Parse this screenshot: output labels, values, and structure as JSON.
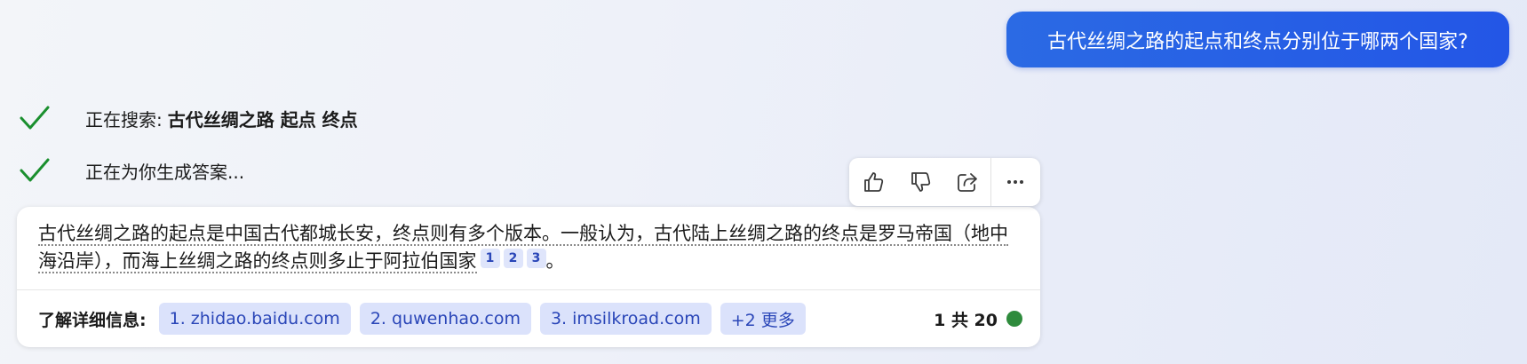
{
  "user_message": "古代丝绸之路的起点和终点分别位于哪两个国家?",
  "status": {
    "searching_label": "正在搜索:",
    "searching_query": "古代丝绸之路 起点 终点",
    "generating_label": "正在为你生成答案..."
  },
  "answer": {
    "text_underlined": "古代丝绸之路的起点是中国古代都城长安，终点则有多个版本。一般认为，古代陆上丝绸之路的终点是罗马帝国（地中海沿岸），而海上丝绸之路的终点则多止于阿拉伯国家",
    "citations": [
      "1",
      "2",
      "3"
    ],
    "text_end": "。"
  },
  "references": {
    "label": "了解详细信息:",
    "items": [
      "1. zhidao.baidu.com",
      "2. quwenhao.com",
      "3. imsilkroad.com"
    ],
    "more": "+2 更多"
  },
  "page_count": "1 共 20",
  "actions": [
    {
      "name": "thumbs-up",
      "icon": "thumbs-up-icon"
    },
    {
      "name": "thumbs-down",
      "icon": "thumbs-down-icon"
    },
    {
      "name": "share",
      "icon": "share-icon"
    },
    {
      "name": "more",
      "icon": "more-icon"
    }
  ],
  "colors": {
    "user_bubble": "#2356e6",
    "check": "#1a8f2e",
    "ref_chip_bg": "#dbe2fb",
    "ref_chip_text": "#2a46b8",
    "status_dot": "#2e8b3c"
  }
}
